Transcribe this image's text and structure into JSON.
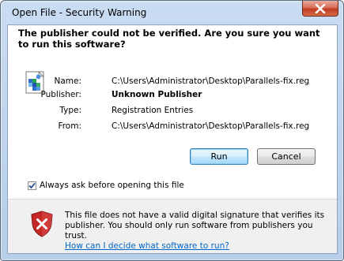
{
  "window": {
    "title": "Open File - Security Warning"
  },
  "headline": "The publisher could not be verified.  Are you sure you want to run this software?",
  "file_info": {
    "rows": [
      {
        "label": "Name:",
        "value": "C:\\Users\\Administrator\\Desktop\\Parallels-fix.reg",
        "bold": false
      },
      {
        "label": "Publisher:",
        "value": "Unknown Publisher",
        "bold": true
      },
      {
        "label": "Type:",
        "value": "Registration Entries",
        "bold": false
      },
      {
        "label": "From:",
        "value": "C:\\Users\\Administrator\\Desktop\\Parallels-fix.reg",
        "bold": false
      }
    ]
  },
  "buttons": {
    "run": "Run",
    "cancel": "Cancel"
  },
  "checkbox": {
    "label": "Always ask before opening this file",
    "checked": true
  },
  "warning": {
    "text": "This file does not have a valid digital signature that verifies its publisher.  You should only run software from publishers you trust.",
    "link": "How can I decide what software to run?"
  },
  "icons": {
    "close": "close-icon",
    "file": "registry-file-icon",
    "shield": "security-shield-error-icon",
    "check": "checkmark-icon"
  },
  "colors": {
    "title_frame": "#c9dcf2",
    "close_red": "#c13c22",
    "link": "#0066cc",
    "shield_red": "#c62828"
  }
}
